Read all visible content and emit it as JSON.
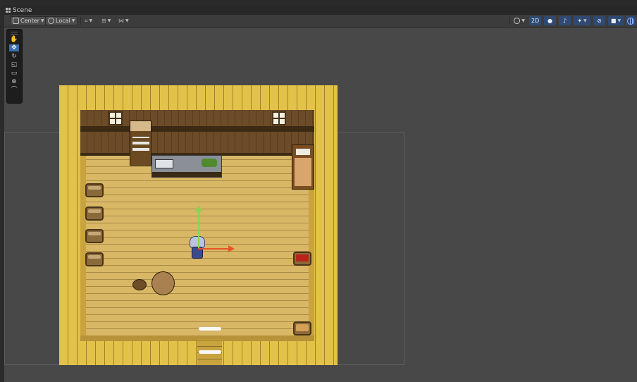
{
  "panel": {
    "tab_label": "Scene"
  },
  "toolbar": {
    "pivot_label": "Center",
    "handle_label": "Local",
    "mode_2d_label": "2D"
  },
  "tools": [
    "view",
    "move",
    "rotate",
    "scale",
    "rect",
    "transform",
    "custom"
  ],
  "colors": {
    "active_blue": "#3a6db5",
    "gizmo_y": "#8fd14f",
    "gizmo_x": "#e8532a",
    "floor": "#d8b766"
  },
  "icons": {
    "hand_tool": "hand-icon",
    "move_tool": "move-arrows-icon",
    "gizmos": "globe-icon"
  }
}
